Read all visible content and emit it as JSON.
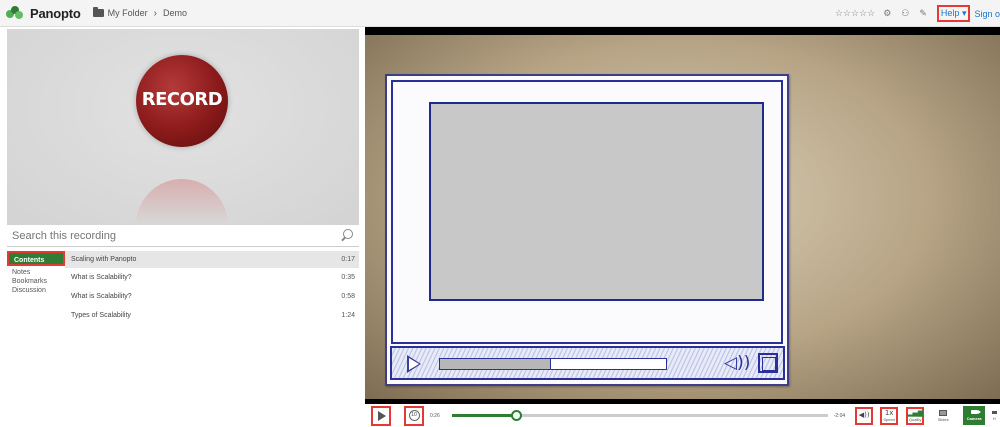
{
  "header": {
    "logo_text": "Panopto",
    "breadcrumb": {
      "folder": "My Folder",
      "separator": "›",
      "current": "Demo"
    },
    "rating": "☆☆☆☆☆",
    "help_label": "Help",
    "help_caret": "▾",
    "signin_label": "Sign o"
  },
  "thumbnail": {
    "label": "RECORD",
    "accent": "#8b1a1a"
  },
  "search": {
    "placeholder": "Search this recording"
  },
  "tabs": {
    "contents": "Contents",
    "notes": "Notes",
    "bookmarks": "Bookmarks",
    "discussion": "Discussion"
  },
  "contents": [
    {
      "title": "Scaling with Panopto",
      "time": "0:17"
    },
    {
      "title": "What is Scalability?",
      "time": "0:35"
    },
    {
      "title": "What is Scalability?",
      "time": "0:58"
    },
    {
      "title": "Types of Scalability",
      "time": "1:24"
    }
  ],
  "player": {
    "elapsed": "0:26",
    "remaining": "-2:04",
    "progress": 0.17,
    "sketch_progress": 0.49,
    "rewind_label": "10",
    "speed_value": "1x",
    "speed_label": "Speed",
    "quality_label": "Quality",
    "slides_label": "Slides",
    "camera_label": "Camera",
    "hide_label": "H",
    "accent": "#2e7d32"
  }
}
